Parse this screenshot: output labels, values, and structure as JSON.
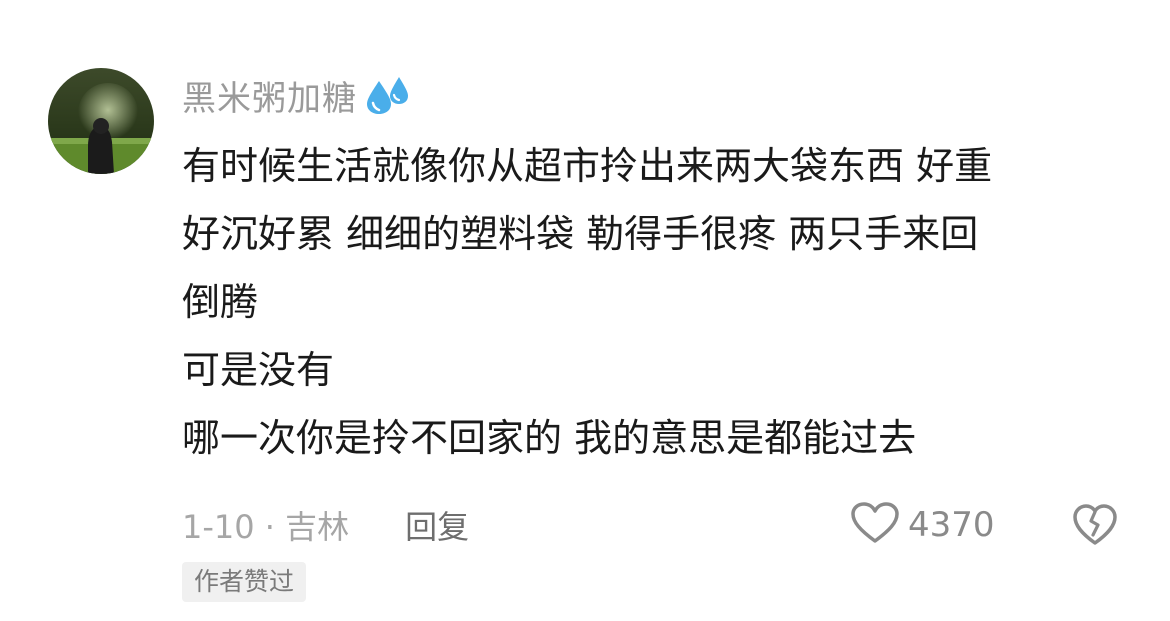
{
  "comment": {
    "username": "黑米粥加糖",
    "username_icon": "sweat-droplets-icon",
    "lines": [
      "有时候生活就像你从超市拎出来两大袋东西 好重",
      "好沉好累 细细的塑料袋 勒得手很疼 两只手来回",
      "倒腾",
      "可是没有",
      "哪一次你是拎不回家的 我的意思是都能过去"
    ],
    "date_location": "1-10 · 吉林",
    "reply_label": "回复",
    "like_count": "4370",
    "author_badge": "作者赞过"
  },
  "colors": {
    "username": "#9a9a9a",
    "body_text": "#1a1a1a",
    "meta_text": "#a6a6a6",
    "droplet": "#4aaeea",
    "badge_bg": "#f0f0f0"
  }
}
